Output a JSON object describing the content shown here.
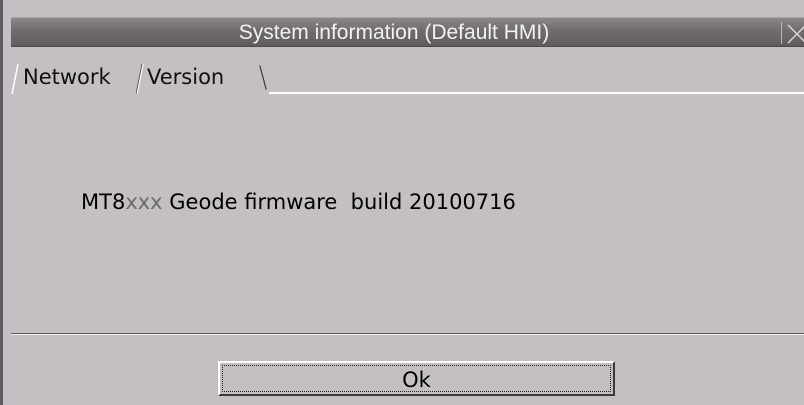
{
  "window": {
    "title": "System information (Default HMI)"
  },
  "tabs": [
    {
      "label": "Network",
      "selected": false
    },
    {
      "label": "Version",
      "selected": true
    }
  ],
  "version_panel": {
    "model_prefix": "MT8",
    "model_suffix": "xxx",
    "firmware_text": " Geode firmware  build 20100716"
  },
  "footer": {
    "ok_label": "Ok"
  },
  "icons": {
    "close": "close-icon"
  },
  "colors": {
    "background": "#c3bfc3",
    "titlebar": "#6f6b6e",
    "title_text": "#f2f2f2"
  }
}
